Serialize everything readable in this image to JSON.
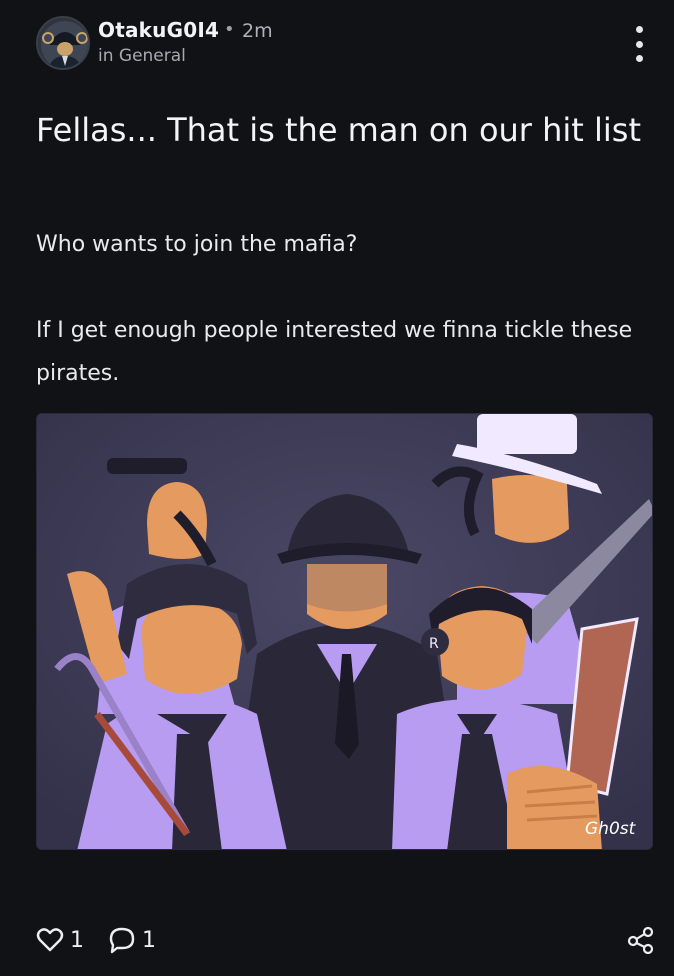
{
  "post": {
    "author": "OtakuG0I4",
    "separator": "•",
    "time": "2m",
    "community": "in General",
    "title": "Fellas... That is the man on our hit list",
    "paragraphs": [
      "Who wants to join the mafia?",
      "If I get enough people interested we finna tickle these pirates."
    ],
    "image": {
      "signature": "Gh0st"
    }
  },
  "footer": {
    "like_count": "1",
    "comment_count": "1"
  },
  "icons": {
    "more": "more-vertical-icon",
    "like": "heart-icon",
    "comment": "comment-bubble-icon",
    "share": "share-icon"
  },
  "colors": {
    "background": "#111216",
    "text": "#ecedf0",
    "muted": "#a5aab2",
    "image_purple": "#b79cf2",
    "image_skin": "#e59a5f"
  }
}
